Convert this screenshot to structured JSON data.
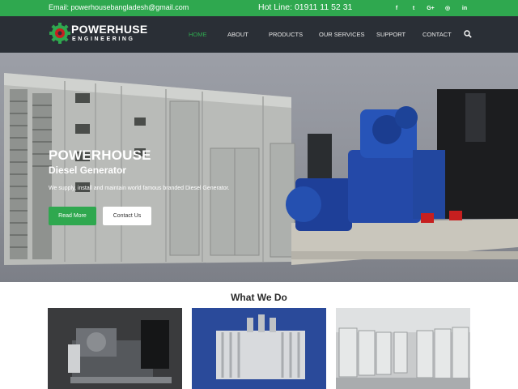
{
  "topbar": {
    "email": "Email: powerhousebangladesh@gmail.com",
    "hotline": "Hot Line: 01911 11 52 31",
    "social": [
      {
        "icon": "facebook-icon",
        "glyph": "f"
      },
      {
        "icon": "twitter-icon",
        "glyph": "t"
      },
      {
        "icon": "google-plus-icon",
        "glyph": "G+"
      },
      {
        "icon": "dribbble-icon",
        "glyph": "◎"
      },
      {
        "icon": "linkedin-icon",
        "glyph": "in"
      }
    ]
  },
  "logo": {
    "brand_pre": "POWER",
    "brand_post": "USE",
    "brand_letter_h": "H",
    "sub": "ENGINEERING"
  },
  "nav": {
    "items": [
      "HOME",
      "ABOUT",
      "PRODUCTS",
      "OUR SERVICES",
      "SUPPORT",
      "CONTACT"
    ],
    "active": "HOME"
  },
  "hero": {
    "title": "POWERHOUSE",
    "subtitle": "Diesel Generator",
    "description": "We supply, install and maintain world famous branded Diesel Generator.",
    "read_more": "Read More",
    "contact_us": "Contact Us"
  },
  "services": {
    "title": "What We Do"
  },
  "colors": {
    "accent": "#2fa84f",
    "nav_bg": "#2a2f36",
    "engine_blue": "#2647a0"
  }
}
